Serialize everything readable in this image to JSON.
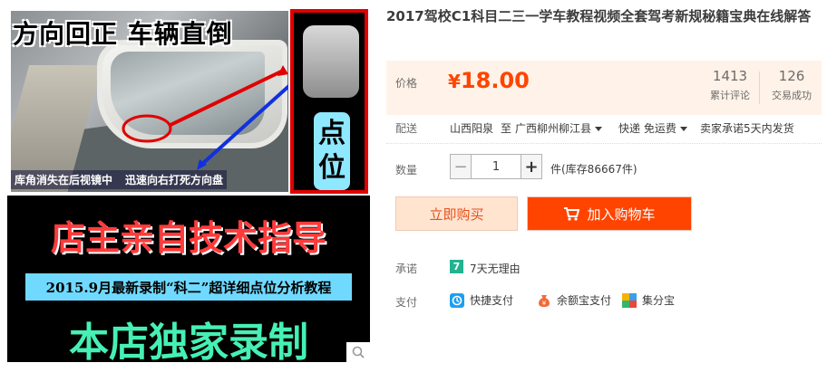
{
  "product_image": {
    "overlay_title": "方向回正 车辆直倒",
    "overlay_caption_1": "库角消失在后视镜中",
    "overlay_caption_2": "迅速向右打死方向盘",
    "spot_label_1": "点",
    "spot_label_2": "位",
    "guide_line": "店主亲自技术指导",
    "record_line": "2015.9月最新录制“科二”超详细点位分析教程",
    "exclusive_line": "本店独家录制",
    "zoom_icon": "magnifier-icon"
  },
  "product": {
    "title": "2017驾校C1科目二三一学车教程视频全套驾考新规秘籍宝典在线解答"
  },
  "price_panel": {
    "label": "价格",
    "currency": "¥",
    "amount": "18.00",
    "reviews_count": "1413",
    "reviews_label": "累计评论",
    "sales_count": "126",
    "sales_label": "交易成功"
  },
  "shipping": {
    "label": "配送",
    "origin": "山西阳泉",
    "to": "至",
    "destination": "广西柳州柳江县",
    "method": "快递 免运费",
    "promise": "卖家承诺5天内发货"
  },
  "quantity": {
    "label": "数量",
    "minus": "−",
    "value": "1",
    "plus": "+",
    "stock": "件(库存86667件)"
  },
  "actions": {
    "buy_now": "立即购买",
    "add_to_cart": "加入购物车"
  },
  "promise": {
    "label": "承诺",
    "badge": "7",
    "text": "7天无理由"
  },
  "payment": {
    "label": "支付",
    "methods": [
      {
        "label": "快捷支付",
        "icon": "quick-pay-icon"
      },
      {
        "label": "余额宝支付",
        "icon": "yuebao-icon"
      },
      {
        "label": "集分宝",
        "icon": "jifenbao-icon"
      }
    ]
  },
  "colors": {
    "price_orange": "#ff4400",
    "price_panel_bg": "#fff2e8",
    "buy_btn_bg": "#ffe4d0",
    "seven_day_green": "#23b290",
    "quick_pay_blue": "#1e9ef0"
  }
}
